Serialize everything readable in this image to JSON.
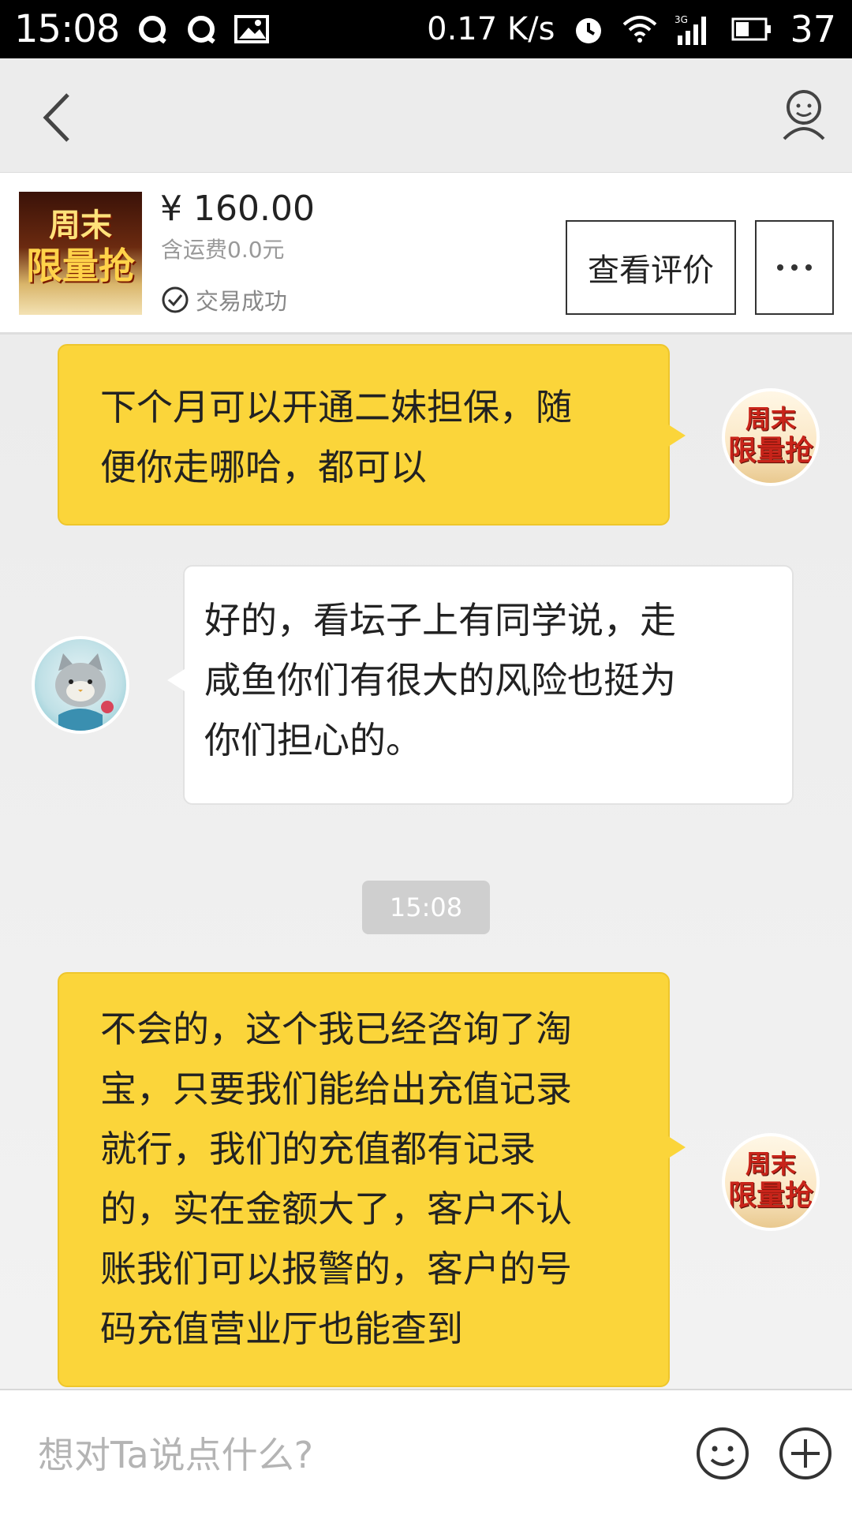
{
  "status_bar": {
    "time": "15:08",
    "speed": "0.17 K/s",
    "network": "3G",
    "battery": "37",
    "icons": [
      "qq-icon",
      "qq-icon",
      "image-icon",
      "alarm-icon",
      "wifi-icon",
      "signal-icon",
      "battery-icon"
    ]
  },
  "nav": {
    "back_icon": "chevron-left-icon",
    "user_icon": "user-icon"
  },
  "product": {
    "price": "¥ 160.00",
    "shipping": "含运费0.0元",
    "status": "交易成功",
    "review_button": "查看评价",
    "thumb_line1": "周末",
    "thumb_line2": "限量抢"
  },
  "messages": [
    {
      "sender": "me",
      "text_lines": [
        "下个月可以开通二妹担保，随",
        "便你走哪哈，都可以"
      ]
    },
    {
      "sender": "them",
      "text_lines": [
        "好的，看坛子上有同学说，走",
        "咸鱼你们有很大的风险也挺为",
        "你们担心的。"
      ]
    },
    {
      "sender": "me",
      "text_lines": [
        "不会的，这个我已经咨询了淘",
        "宝，只要我们能给出充值记录",
        "就行，我们的充值都有记录",
        "的，实在金额大了，客户不认",
        "账我们可以报警的，客户的号",
        "码充值营业厅也能查到"
      ]
    }
  ],
  "timestamp": "15:08",
  "input": {
    "placeholder": "想对Ta说点什么?"
  },
  "colors": {
    "my_bubble": "#fbd53a",
    "their_bubble": "#ffffff",
    "status_bar": "#000000"
  }
}
